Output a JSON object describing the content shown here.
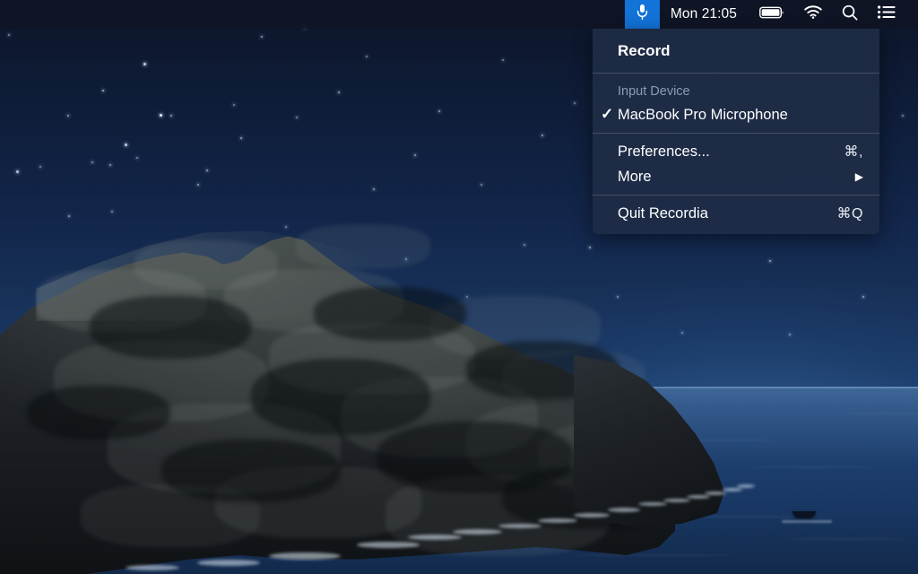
{
  "menubar": {
    "app_icon": "microphone-icon",
    "clock": "Mon 21:05",
    "status_icons": [
      {
        "name": "battery-icon",
        "label": "Battery"
      },
      {
        "name": "wifi-icon",
        "label": "Wi-Fi"
      },
      {
        "name": "search-icon",
        "label": "Spotlight Search"
      },
      {
        "name": "control-center-icon",
        "label": "Control Center"
      }
    ],
    "accent_color": "#1273d8",
    "background_color": "#111626"
  },
  "menu": {
    "title": "Record",
    "section_header": "Input Device",
    "input_devices": [
      {
        "label": "MacBook Pro Microphone",
        "checked": true,
        "check_glyph": "✓"
      }
    ],
    "items": [
      {
        "label": "Preferences...",
        "shortcut": "⌘,"
      },
      {
        "label": "More",
        "shortcut": "",
        "submenu_glyph": "▶"
      }
    ],
    "quit": {
      "label": "Quit Recordia",
      "shortcut": "⌘Q"
    },
    "background_color": "#1e2c46",
    "separator_color": "#566274"
  },
  "desktop": {
    "wallpaper_name": "catalina-night-coast",
    "sky_top_color": "#0c1429",
    "sky_bottom_color": "#1e4070",
    "ocean_color": "#1f4272",
    "terrain_color": "#22262b"
  }
}
